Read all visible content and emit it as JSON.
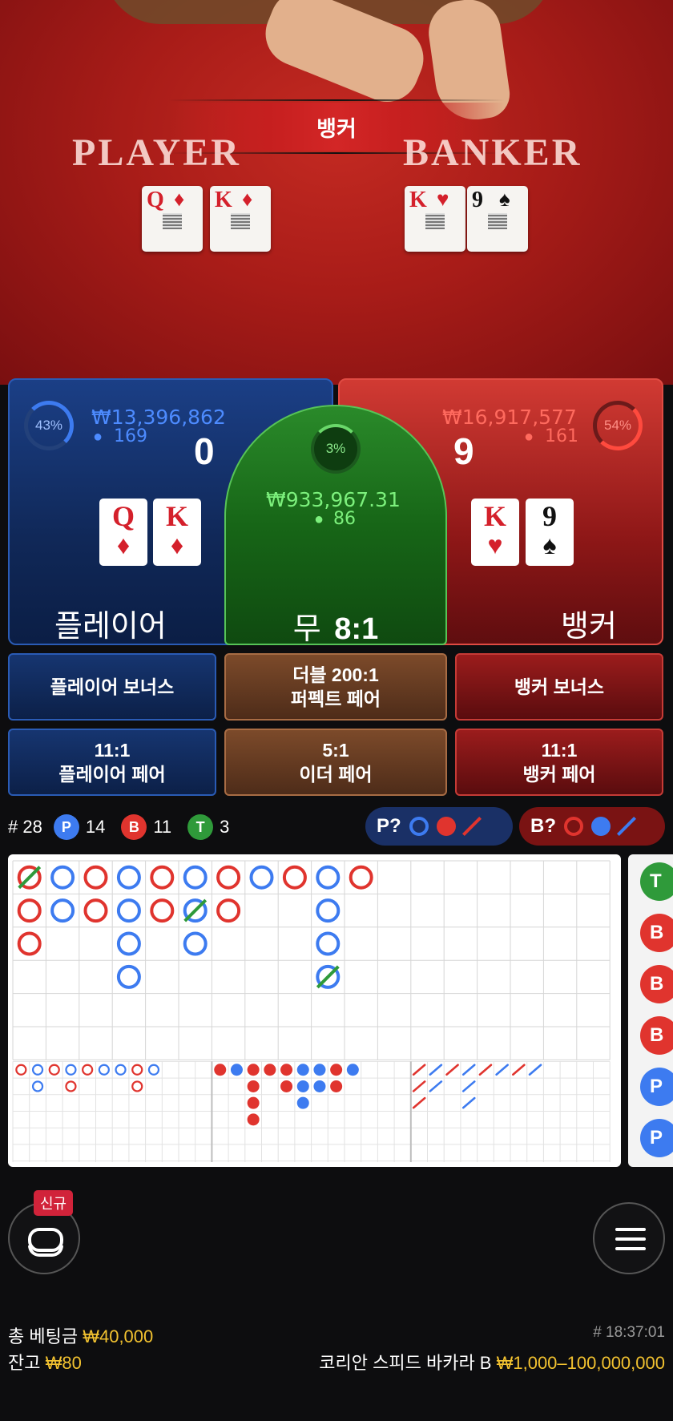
{
  "video": {
    "result_banner": "뱅커",
    "player_label": "PLAYER",
    "banker_label": "BANKER",
    "player_cards": [
      {
        "rank": "Q",
        "suit": "♦",
        "color": "red"
      },
      {
        "rank": "K",
        "suit": "♦",
        "color": "red"
      }
    ],
    "banker_cards": [
      {
        "rank": "K",
        "suit": "♥",
        "color": "red"
      },
      {
        "rank": "9",
        "suit": "♠",
        "color": "black"
      }
    ]
  },
  "player": {
    "percent": "43%",
    "amount": "₩13,396,862",
    "bettors": "169",
    "score": "0",
    "cards": [
      {
        "rank": "Q",
        "suit": "♦"
      },
      {
        "rank": "K",
        "suit": "♦"
      }
    ],
    "label": "플레이어"
  },
  "tie": {
    "percent": "3%",
    "amount": "₩933,967.31",
    "bettors": "86",
    "label": "무",
    "payout": "8:1"
  },
  "banker": {
    "percent": "54%",
    "amount": "₩16,917,577",
    "bettors": "161",
    "score": "9",
    "cards": [
      {
        "rank": "K",
        "suit": "♥"
      },
      {
        "rank": "9",
        "suit": "♠"
      }
    ],
    "label": "뱅커"
  },
  "side_bets": {
    "player_bonus": "플레이어 보너스",
    "perfect_pair_line1": "더블 200:1",
    "perfect_pair_line2": "퍼펙트 페어",
    "banker_bonus": "뱅커 보너스",
    "player_pair_line1": "11:1",
    "player_pair_line2": "플레이어 페어",
    "either_pair_line1": "5:1",
    "either_pair_line2": "이더 페어",
    "banker_pair_line1": "11:1",
    "banker_pair_line2": "뱅커 페어"
  },
  "stats": {
    "round": "# 28",
    "p_letter": "P",
    "p_count": "14",
    "b_letter": "B",
    "b_count": "11",
    "t_letter": "T",
    "t_count": "3"
  },
  "predictions": {
    "player_label": "P?",
    "banker_label": "B?"
  },
  "road_side": [
    "T",
    "B",
    "B",
    "B",
    "P",
    "P"
  ],
  "colors": {
    "player_blue": "#3d7bf0",
    "banker_red": "#e0342e",
    "tie_green": "#2f9a3a",
    "gold": "#f2c230"
  },
  "bottom": {
    "new_badge": "신규",
    "total_bet_label": "총 베팅금",
    "total_bet_value": "₩40,000",
    "balance_label": "잔고",
    "balance_value": "₩80",
    "time": "# 18:37:01",
    "table_name": "코리안 스피드 바카라 B",
    "limits": "₩1,000–100,000,000"
  },
  "icons": [
    "chips-icon",
    "menu-icon",
    "user-icon"
  ]
}
